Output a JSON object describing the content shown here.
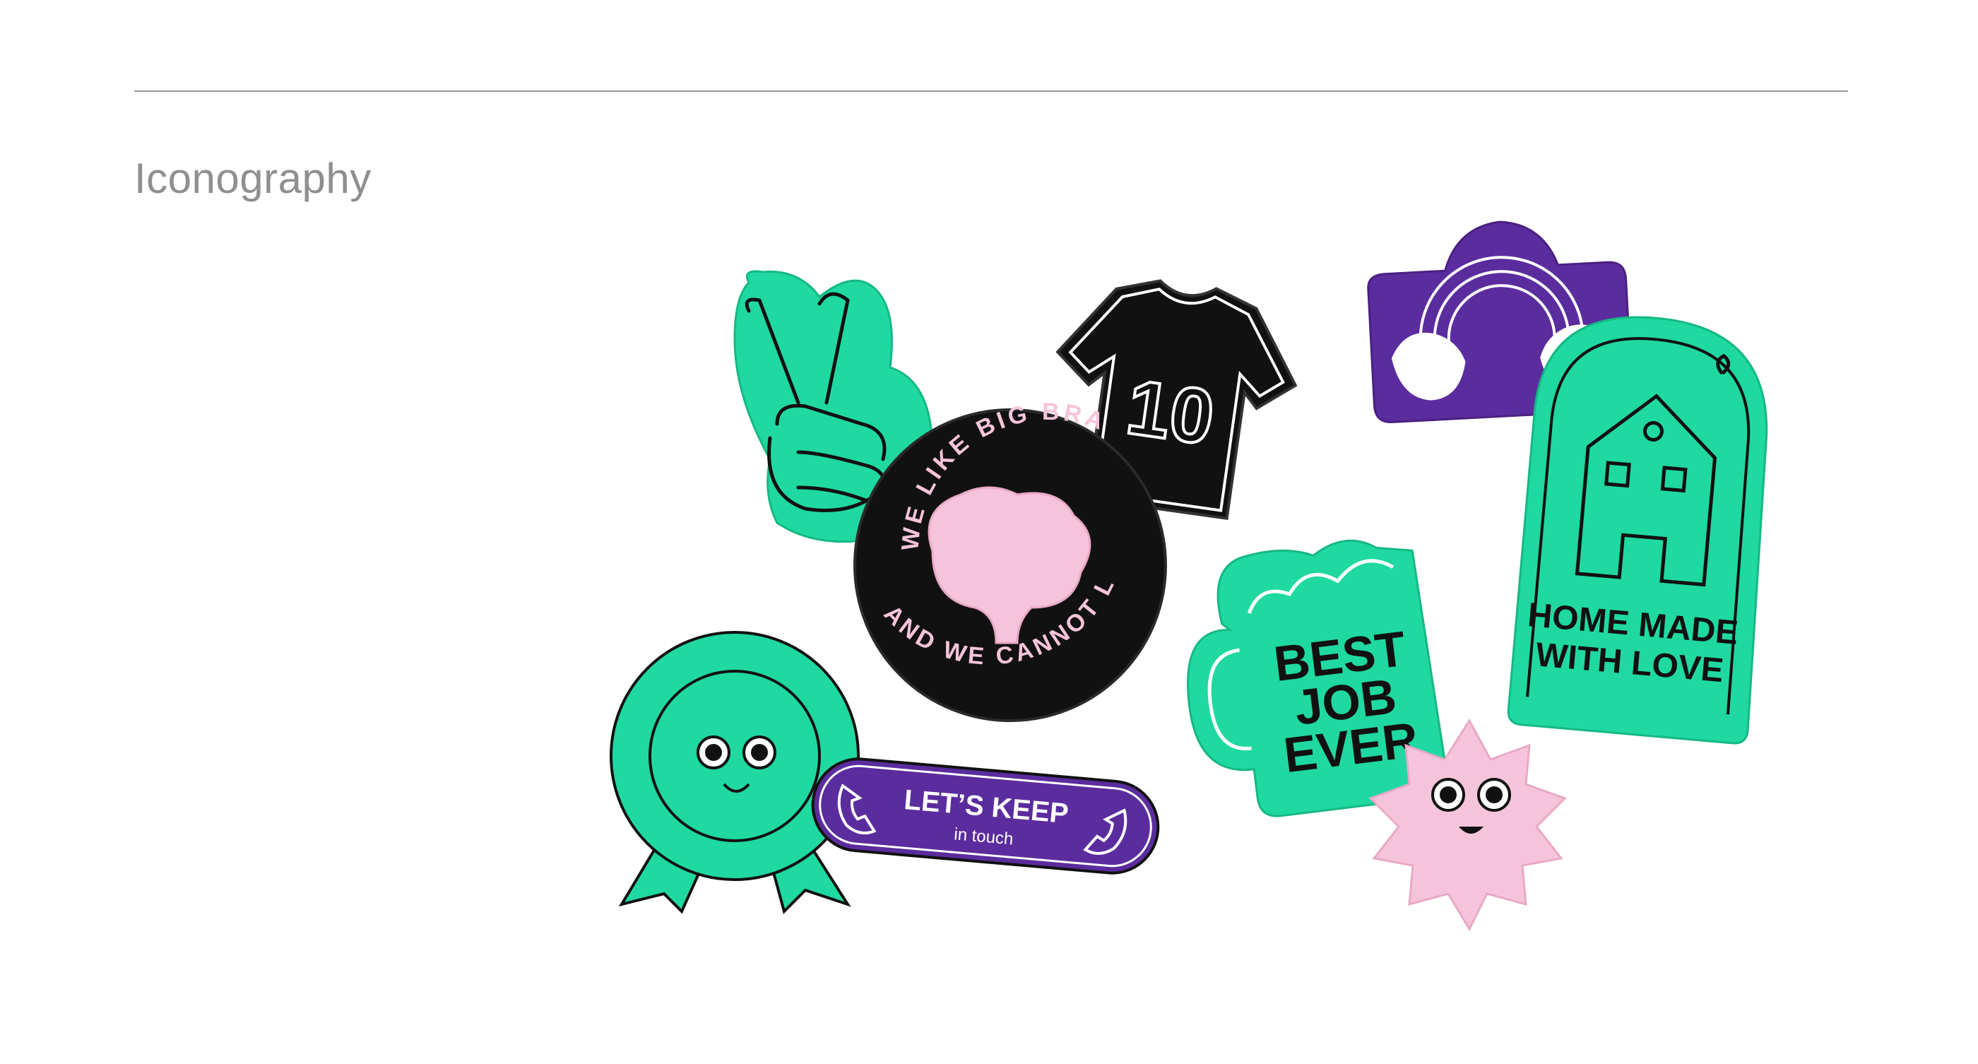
{
  "section": {
    "title": "Iconography"
  },
  "stickers": {
    "peace_hand": {
      "icon": "peace-hand-icon"
    },
    "jersey": {
      "number": "10",
      "icon": "tshirt-icon"
    },
    "rainbow_hands": {
      "icon": "rainbow-hands-icon"
    },
    "brain": {
      "top_text": "WE LIKE BIG BRAINS",
      "bottom_text": "AND WE CANNOT LIE",
      "icon": "brain-icon"
    },
    "home": {
      "line1": "HOME MADE",
      "line2": "WITH LOVE",
      "icon": "house-icon"
    },
    "mug": {
      "line1": "BEST",
      "line2": "JOB",
      "line3": "EVER",
      "icon": "mug-icon"
    },
    "rosette": {
      "icon": "rosette-face-icon"
    },
    "phone_pill": {
      "title": "LET’S KEEP",
      "subtitle": "in touch",
      "icon": "phone-icon"
    },
    "starburst": {
      "icon": "starburst-face-icon"
    }
  },
  "colors": {
    "green": "#1FD9A0",
    "purple": "#5B2C9E",
    "black": "#111111",
    "pink": "#F6C4DA",
    "heading_gray": "#8f8f8f",
    "rule_gray": "#9a9a9a"
  }
}
